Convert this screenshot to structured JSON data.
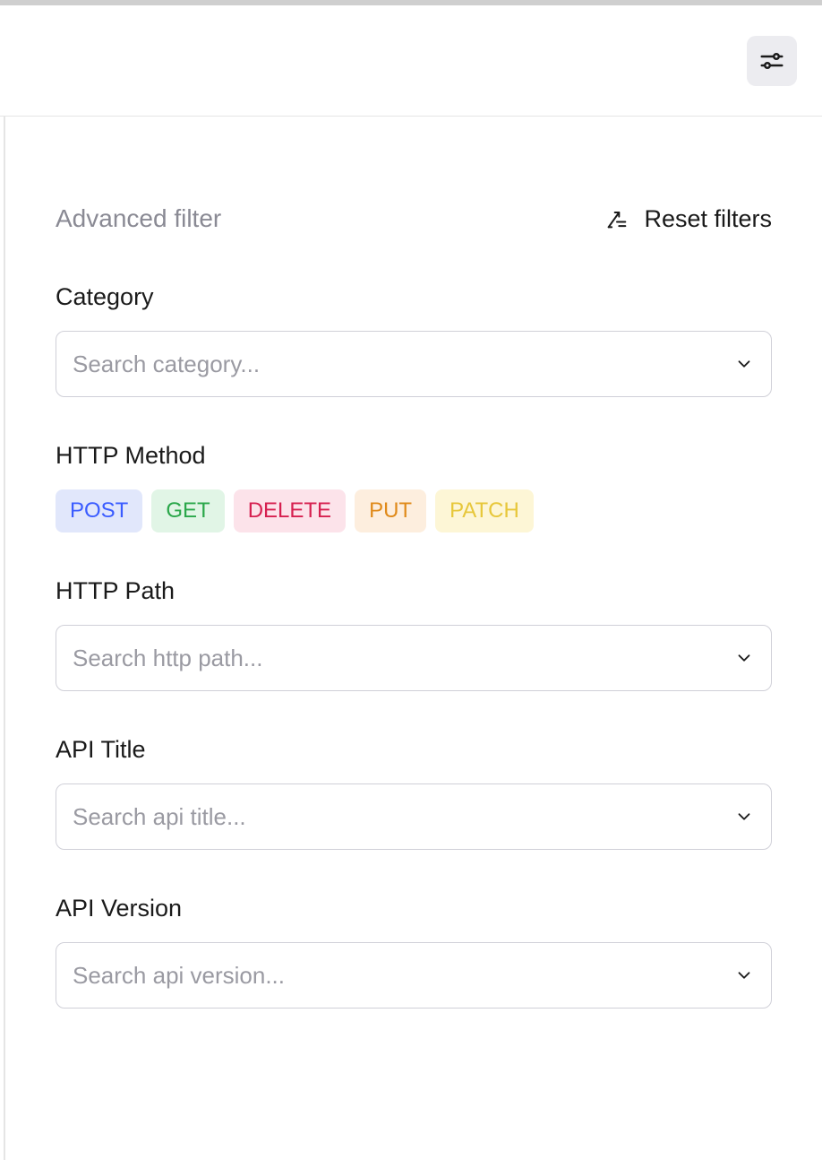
{
  "header": {
    "title": "Advanced filter",
    "reset_label": "Reset filters"
  },
  "fields": {
    "category": {
      "label": "Category",
      "placeholder": "Search category..."
    },
    "http_method": {
      "label": "HTTP Method",
      "options": {
        "post": "POST",
        "get": "GET",
        "delete": "DELETE",
        "put": "PUT",
        "patch": "PATCH"
      }
    },
    "http_path": {
      "label": "HTTP Path",
      "placeholder": "Search http path..."
    },
    "api_title": {
      "label": "API Title",
      "placeholder": "Search api title..."
    },
    "api_version": {
      "label": "API Version",
      "placeholder": "Search api version..."
    }
  }
}
